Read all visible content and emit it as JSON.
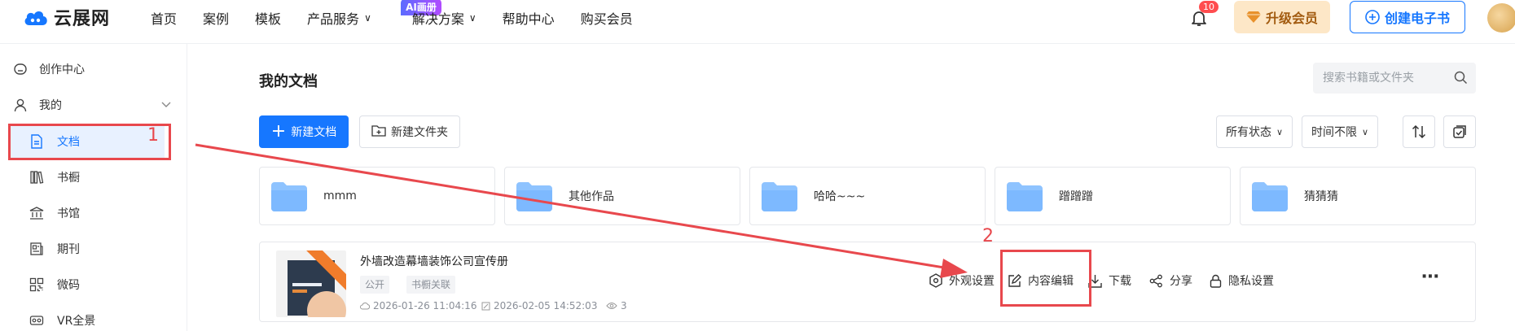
{
  "brand": {
    "name": "云展网"
  },
  "nav": {
    "items": [
      "首页",
      "案例",
      "模板",
      "产品服务",
      "解决方案",
      "帮助中心",
      "购买会员"
    ],
    "ai_badge": "AI画册"
  },
  "header": {
    "notification_count": "10",
    "upgrade_label": "升级会员",
    "create_label": "创建电子书"
  },
  "sidebar": {
    "items": [
      {
        "label": "创作中心",
        "icon": "home-icon"
      },
      {
        "label": "我的",
        "icon": "user-icon"
      },
      {
        "label": "文档",
        "icon": "document-icon"
      },
      {
        "label": "书橱",
        "icon": "bookshelf-icon"
      },
      {
        "label": "书馆",
        "icon": "library-icon"
      },
      {
        "label": "期刊",
        "icon": "journal-icon"
      },
      {
        "label": "微码",
        "icon": "qrcode-icon"
      },
      {
        "label": "VR全景",
        "icon": "vr-icon"
      }
    ]
  },
  "main": {
    "title": "我的文档",
    "search_placeholder": "搜索书籍或文件夹",
    "new_doc_label": "新建文档",
    "new_folder_label": "新建文件夹",
    "filter_status": "所有状态",
    "filter_time": "时间不限"
  },
  "folders": [
    {
      "name": "mmm"
    },
    {
      "name": "其他作品"
    },
    {
      "name": "哈哈~~~"
    },
    {
      "name": "蹭蹭蹭"
    },
    {
      "name": "猜猜猜"
    }
  ],
  "document": {
    "title": "外墙改造幕墙装饰公司宣传册",
    "tags": [
      "公开",
      "书橱关联"
    ],
    "created": "2026-01-26 11:04:16",
    "updated": "2026-02-05 14:52:03",
    "views": "3",
    "actions": [
      "外观设置",
      "内容编辑",
      "下载",
      "分享",
      "隐私设置"
    ]
  },
  "annotations": {
    "step1": "1",
    "step2": "2",
    "color": "#e8484d"
  },
  "colors": {
    "primary": "#1677ff",
    "active_bg": "#e8f1ff",
    "upgrade_bg": "#fde7c7",
    "folder": "#7db9ff"
  }
}
